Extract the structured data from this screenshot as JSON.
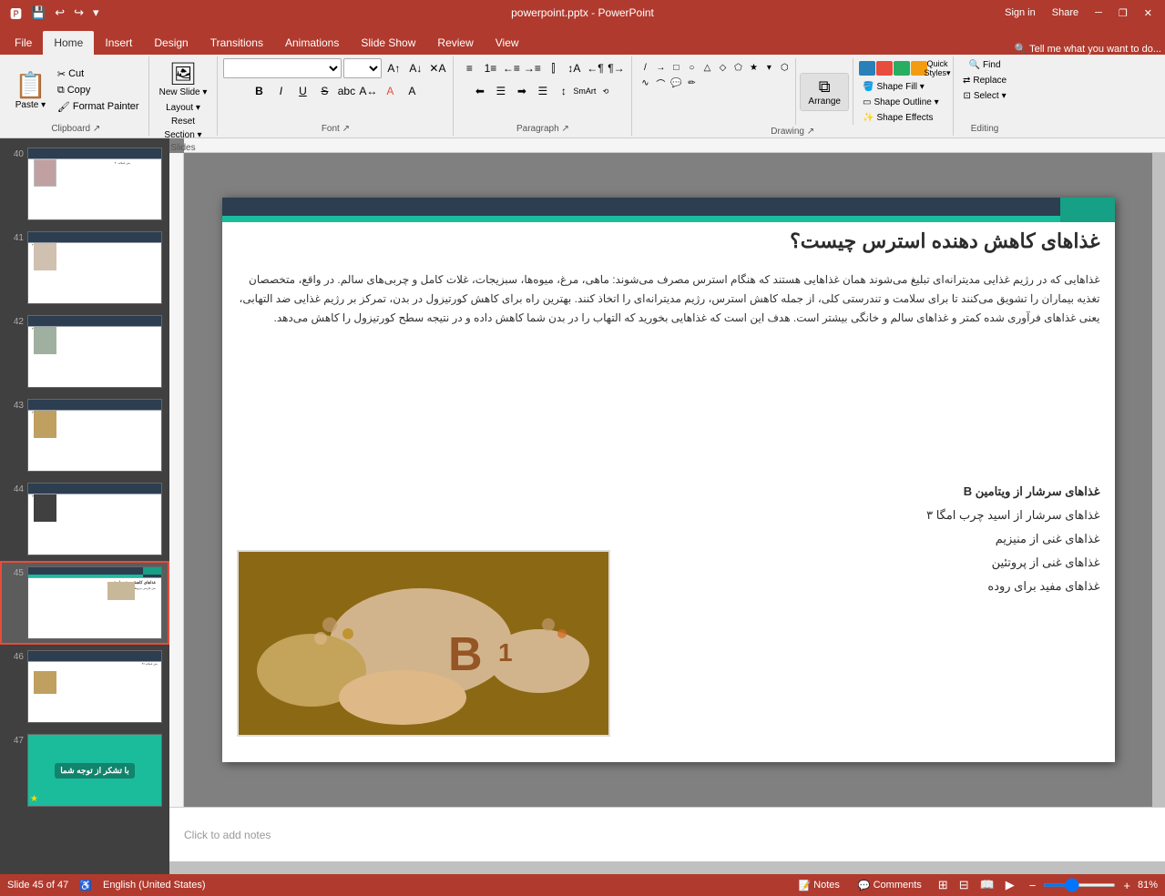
{
  "titlebar": {
    "filename": "powerpoint.pptx - PowerPoint",
    "quick_access": [
      "save",
      "undo",
      "redo",
      "customize"
    ],
    "controls": [
      "minimize",
      "restore",
      "close"
    ],
    "sign_in": "Sign in",
    "share": "Share"
  },
  "ribbon": {
    "tabs": [
      "File",
      "Home",
      "Insert",
      "Design",
      "Transitions",
      "Animations",
      "Slide Show",
      "Review",
      "View"
    ],
    "active_tab": "Home",
    "groups": {
      "clipboard": {
        "label": "Clipboard",
        "paste_label": "Paste",
        "items": [
          "Cut",
          "Copy",
          "Format Painter"
        ]
      },
      "slides": {
        "label": "Slides",
        "new_slide": "New Slide",
        "items": [
          "Layout",
          "Reset",
          "Section"
        ]
      },
      "font": {
        "label": "Font",
        "font_family": "",
        "font_size": "",
        "buttons": [
          "B",
          "I",
          "U",
          "S",
          "abc",
          "A",
          "A",
          "A"
        ]
      },
      "paragraph": {
        "label": "Paragraph",
        "buttons": [
          "bullets",
          "numbering",
          "decrease",
          "increase",
          "cols",
          "rtl",
          "ltr",
          "align"
        ]
      },
      "drawing": {
        "label": "Drawing",
        "arrange": "Arrange",
        "quick_styles": "Quick Styles",
        "shape_fill": "Shape Fill",
        "shape_outline": "Shape Outline",
        "shape_effects": "Shape Effects",
        "shape_label": "Shape"
      },
      "editing": {
        "label": "Editing",
        "find": "Find",
        "replace": "Replace",
        "select": "Select"
      }
    }
  },
  "slide_panel": {
    "slides": [
      {
        "num": 40,
        "active": false,
        "star": false
      },
      {
        "num": 41,
        "active": false,
        "star": false
      },
      {
        "num": 42,
        "active": false,
        "star": false
      },
      {
        "num": 43,
        "active": false,
        "star": false
      },
      {
        "num": 44,
        "active": false,
        "star": false
      },
      {
        "num": 45,
        "active": true,
        "star": false
      },
      {
        "num": 46,
        "active": false,
        "star": false
      },
      {
        "num": 47,
        "active": false,
        "star": true
      }
    ]
  },
  "slide_content": {
    "title": "غذاهای کاهش دهنده استرس چیست؟",
    "body_text": "غذاهایی که در رژیم غذایی مدیترانه‌ای تبلیغ می‌شوند همان غذاهایی هستند که هنگام استرس مصرف می‌شوند: ماهی، مرغ، میوه‌ها، سبزیجات، غلات کامل و چربی‌های سالم. در واقع، متخصصان تغذیه بیماران را تشویق می‌کنند تا برای سلامت و تندرستی کلی، از جمله کاهش استرس، رژیم مدیترانه‌ای را اتخاذ کنند. بهترین راه برای کاهش کورتیزول در بدن، تمرکز بر رژیم غذایی ضد التهابی، یعنی غذاهای فرآوری شده کمتر و غذاهای سالم و خانگی بیشتر است. هدف این است که غذاهایی بخورید که التهاب را در بدن شما کاهش داده و در نتیجه سطح کورتیزول را کاهش می‌دهد.",
    "bullets": [
      {
        "text": "غذاهای سرشار از ویتامین B",
        "bold": true
      },
      {
        "text": "غذاهای سرشار از اسید چرب امگا ۳",
        "bold": false
      },
      {
        "text": "غذاهای غنی از منیزیم",
        "bold": false
      },
      {
        "text": "غذاهای غنی از پروتئین",
        "bold": false
      },
      {
        "text": "غذاهای مفید برای روده",
        "bold": false
      }
    ],
    "notes_placeholder": "Click to add notes"
  },
  "statusbar": {
    "slide_info": "Slide 45 of 47",
    "language": "English (United States)",
    "notes": "Notes",
    "comments": "Comments",
    "zoom": "81%"
  }
}
